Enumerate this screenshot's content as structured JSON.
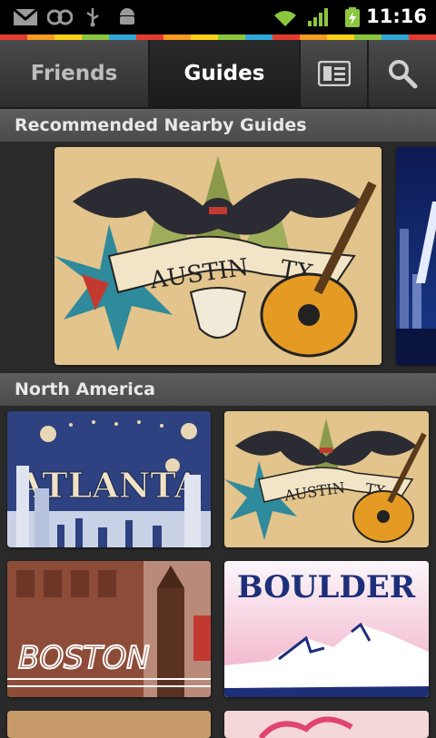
{
  "status_bar": {
    "time": "11:16",
    "icons": [
      "gmail-icon",
      "voicemail-icon",
      "usb-icon",
      "android-icon",
      "wifi-icon",
      "signal-icon",
      "battery-charging-icon"
    ]
  },
  "tabs": [
    {
      "label": "Friends",
      "selected": false
    },
    {
      "label": "Guides",
      "selected": true
    }
  ],
  "toolbar_icons": [
    "list-view-icon",
    "search-icon"
  ],
  "sections": {
    "recommended": {
      "title": "Recommended Nearby Guides",
      "cards": [
        {
          "city": "AUSTIN",
          "state": "TX"
        },
        {
          "city": "",
          "state": ""
        }
      ]
    },
    "north_america": {
      "title": "North America",
      "cards": [
        {
          "city": "ATLANTA"
        },
        {
          "city": "AUSTIN",
          "state": "TX"
        },
        {
          "city": "BOSTON"
        },
        {
          "city": "BOULDER"
        }
      ]
    }
  },
  "colors": {
    "strip": [
      "#e53b2e",
      "#f79a1f",
      "#fcd116",
      "#8cc63f",
      "#2fa8d8",
      "#e53b2e",
      "#f79a1f",
      "#fcd116",
      "#8cc63f",
      "#2fa8d8",
      "#e53b2e",
      "#f79a1f",
      "#fcd116",
      "#8cc63f",
      "#2fa8d8",
      "#e53b2e"
    ],
    "signal_green": "#8cc63f"
  }
}
